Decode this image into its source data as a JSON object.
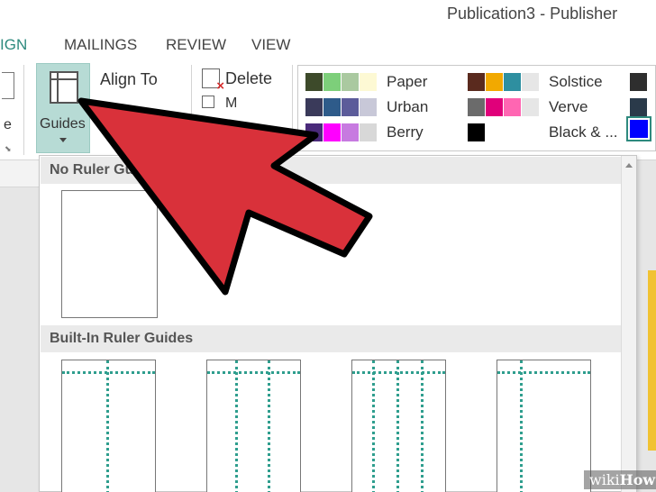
{
  "window": {
    "title": "Publication3 - Publisher"
  },
  "tabs": [
    {
      "label": "IGN",
      "active": true
    },
    {
      "label": "MAILINGS",
      "active": false
    },
    {
      "label": "REVIEW",
      "active": false
    },
    {
      "label": "VIEW",
      "active": false
    }
  ],
  "ribbon": {
    "left_fragment": "e",
    "guides": {
      "label": "Guides",
      "icon": "guides-icon"
    },
    "align_to": {
      "label": "Align To"
    },
    "delete": {
      "label": "Delete",
      "icon": "delete-page-icon"
    },
    "second_row_fragment": "M"
  },
  "color_schemes": {
    "selected": "Black & ...",
    "items": [
      {
        "name": "Paper",
        "colors": [
          "#3d4a2a",
          "#7dcf7a",
          "#aac9a0",
          "#fdf9d4"
        ]
      },
      {
        "name": "Solstice",
        "colors": [
          "#5a2a1e",
          "#f2a900",
          "#2e8fa0",
          "#e6e6e6"
        ]
      },
      {
        "name": "Urban",
        "colors": [
          "#3a3a5a",
          "#2e5b8a",
          "#5c5c9a",
          "#c8c8d8"
        ]
      },
      {
        "name": "Verve",
        "colors": [
          "#6b6b6b",
          "#e0007a",
          "#ff66b2",
          "#e6e6e6"
        ]
      },
      {
        "name": "Berry",
        "colors": [
          "#4a2a7a",
          "#ff00ff",
          "#c77ae0",
          "#d8d8d8"
        ]
      },
      {
        "name": "Black & ...",
        "colors": [
          "#000000"
        ]
      }
    ],
    "extra_colors": [
      "#2e2e2e",
      "#2a3a4a",
      "#0000ff"
    ]
  },
  "gallery": {
    "sections": [
      {
        "title": "No Ruler Guides"
      },
      {
        "title": "Built-In Ruler Guides"
      }
    ]
  },
  "annotation": {
    "type": "red-arrow",
    "color": "#d9313a",
    "points_to": "Guides button"
  },
  "watermark": {
    "prefix": "wiki",
    "suffix": "How"
  }
}
